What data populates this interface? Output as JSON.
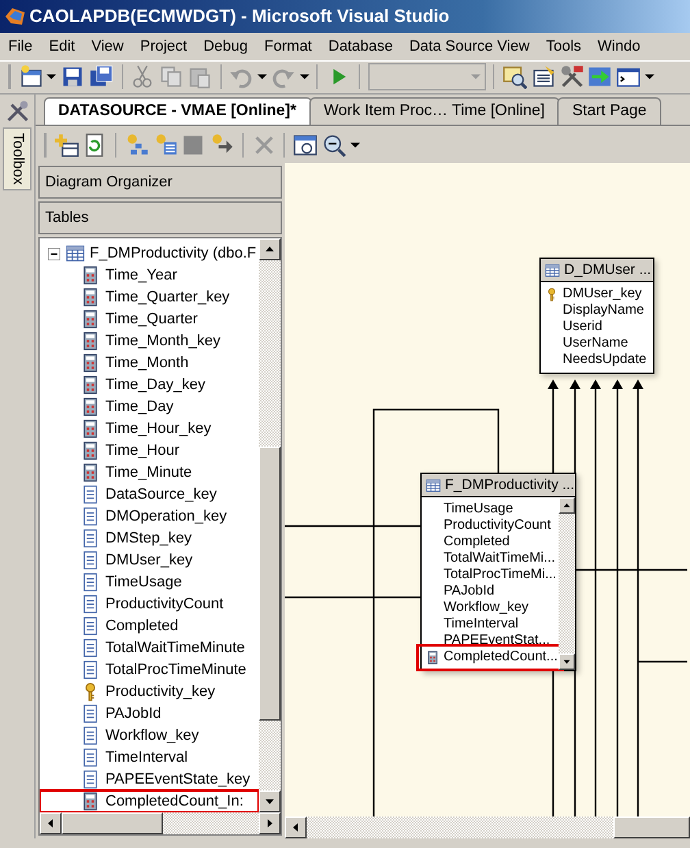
{
  "window": {
    "title": "CAOLAPDB(ECMWDGT) - Microsoft Visual Studio"
  },
  "menu": [
    "File",
    "Edit",
    "View",
    "Project",
    "Debug",
    "Format",
    "Database",
    "Data Source View",
    "Tools",
    "Windo"
  ],
  "toolbox": {
    "label": "Toolbox"
  },
  "tabs": [
    {
      "label": "DATASOURCE - VMAE [Online]*",
      "selected": true
    },
    {
      "label": "Work Item Proc… Time [Online]",
      "selected": false
    },
    {
      "label": "Start Page",
      "selected": false
    }
  ],
  "organizer": {
    "title": "Diagram Organizer"
  },
  "tables_header": "Tables",
  "tree": {
    "label": "F_DMProductivity (dbo.F",
    "expanded": true,
    "children": [
      {
        "label": "Time_Year",
        "kind": "calculated",
        "highlighted": false
      },
      {
        "label": "Time_Quarter_key",
        "kind": "calculated",
        "highlighted": false
      },
      {
        "label": "Time_Quarter",
        "kind": "calculated",
        "highlighted": false
      },
      {
        "label": "Time_Month_key",
        "kind": "calculated",
        "highlighted": false
      },
      {
        "label": "Time_Month",
        "kind": "calculated",
        "highlighted": false
      },
      {
        "label": "Time_Day_key",
        "kind": "calculated",
        "highlighted": false
      },
      {
        "label": "Time_Day",
        "kind": "calculated",
        "highlighted": false
      },
      {
        "label": "Time_Hour_key",
        "kind": "calculated",
        "highlighted": false
      },
      {
        "label": "Time_Hour",
        "kind": "calculated",
        "highlighted": false
      },
      {
        "label": "Time_Minute",
        "kind": "calculated",
        "highlighted": false
      },
      {
        "label": "DataSource_key",
        "kind": "column",
        "highlighted": false
      },
      {
        "label": "DMOperation_key",
        "kind": "column",
        "highlighted": false
      },
      {
        "label": "DMStep_key",
        "kind": "column",
        "highlighted": false
      },
      {
        "label": "DMUser_key",
        "kind": "column",
        "highlighted": false
      },
      {
        "label": "TimeUsage",
        "kind": "column",
        "highlighted": false
      },
      {
        "label": "ProductivityCount",
        "kind": "column",
        "highlighted": false
      },
      {
        "label": "Completed",
        "kind": "column",
        "highlighted": false
      },
      {
        "label": "TotalWaitTimeMinute",
        "kind": "column",
        "highlighted": false
      },
      {
        "label": "TotalProcTimeMinute",
        "kind": "column",
        "highlighted": false
      },
      {
        "label": "Productivity_key",
        "kind": "key",
        "highlighted": false
      },
      {
        "label": "PAJobId",
        "kind": "column",
        "highlighted": false
      },
      {
        "label": "Workflow_key",
        "kind": "column",
        "highlighted": false
      },
      {
        "label": "TimeInterval",
        "kind": "column",
        "highlighted": false
      },
      {
        "label": "PAPEEventState_key",
        "kind": "column",
        "highlighted": false
      },
      {
        "label": "CompletedCount_In:",
        "kind": "calculated",
        "highlighted": true
      }
    ]
  },
  "diagram": {
    "tables": [
      {
        "title": "D_DMUser ...",
        "scrollable": false,
        "columns": [
          {
            "label": "DMUser_key",
            "kind": "key",
            "highlighted": false
          },
          {
            "label": "DisplayName",
            "kind": "column",
            "highlighted": false
          },
          {
            "label": "Userid",
            "kind": "column",
            "highlighted": false
          },
          {
            "label": "UserName",
            "kind": "column",
            "highlighted": false
          },
          {
            "label": "NeedsUpdate",
            "kind": "column",
            "highlighted": false
          }
        ]
      },
      {
        "title": "F_DMProductivity ...",
        "scrollable": true,
        "columns": [
          {
            "label": "TimeUsage",
            "kind": "column",
            "highlighted": false
          },
          {
            "label": "ProductivityCount",
            "kind": "column",
            "highlighted": false
          },
          {
            "label": "Completed",
            "kind": "column",
            "highlighted": false
          },
          {
            "label": "TotalWaitTimeMi...",
            "kind": "column",
            "highlighted": false
          },
          {
            "label": "TotalProcTimeMi...",
            "kind": "column",
            "highlighted": false
          },
          {
            "label": "PAJobId",
            "kind": "column",
            "highlighted": false
          },
          {
            "label": "Workflow_key",
            "kind": "column",
            "highlighted": false
          },
          {
            "label": "TimeInterval",
            "kind": "column",
            "highlighted": false
          },
          {
            "label": "PAPEEventStat...",
            "kind": "column",
            "highlighted": false
          },
          {
            "label": "CompletedCount...",
            "kind": "calculated",
            "highlighted": true
          }
        ]
      }
    ]
  }
}
